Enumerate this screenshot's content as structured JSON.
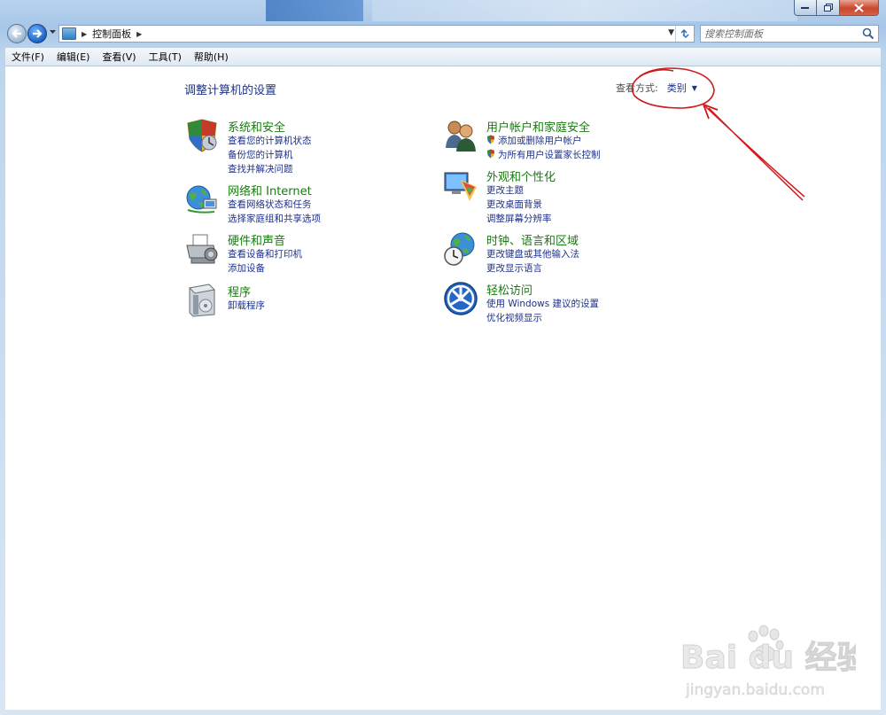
{
  "window": {
    "minimize_label": "",
    "maximize_label": "",
    "close_label": ""
  },
  "address_bar": {
    "crumbs": [
      "控制面板"
    ],
    "search_placeholder": "搜索控制面板"
  },
  "menu": {
    "items": [
      "文件(F)",
      "编辑(E)",
      "查看(V)",
      "工具(T)",
      "帮助(H)"
    ]
  },
  "main": {
    "title": "调整计算机的设置",
    "view_by_label": "查看方式:",
    "view_by_value": "类别"
  },
  "categories": [
    {
      "icon": "shield-icon",
      "title": "系统和安全",
      "links": [
        "查看您的计算机状态",
        "备份您的计算机",
        "查找并解决问题"
      ]
    },
    {
      "icon": "network-globe-icon",
      "title": "网络和 Internet",
      "links": [
        "查看网络状态和任务",
        "选择家庭组和共享选项"
      ]
    },
    {
      "icon": "printer-icon",
      "title": "硬件和声音",
      "links": [
        "查看设备和打印机",
        "添加设备"
      ]
    },
    {
      "icon": "program-box-icon",
      "title": "程序",
      "links": [
        "卸载程序"
      ]
    },
    {
      "icon": "users-icon",
      "title": "用户帐户和家庭安全",
      "links": [
        "添加或删除用户帐户",
        "为所有用户设置家长控制"
      ]
    },
    {
      "icon": "monitor-palette-icon",
      "title": "外观和个性化",
      "links": [
        "更改主题",
        "更改桌面背景",
        "调整屏幕分辨率"
      ]
    },
    {
      "icon": "clock-globe-icon",
      "title": "时钟、语言和区域",
      "links": [
        "更改键盘或其他输入法",
        "更改显示语言"
      ]
    },
    {
      "icon": "ease-of-access-icon",
      "title": "轻松访问",
      "links": [
        "使用 Windows 建议的设置",
        "优化视频显示"
      ]
    }
  ],
  "watermark": {
    "brand": "Bai du 经验",
    "url": "jingyan.baidu.com"
  },
  "colors": {
    "category_title": "#1a7b12",
    "link": "#1e3287",
    "annotation": "#d11a1a"
  }
}
